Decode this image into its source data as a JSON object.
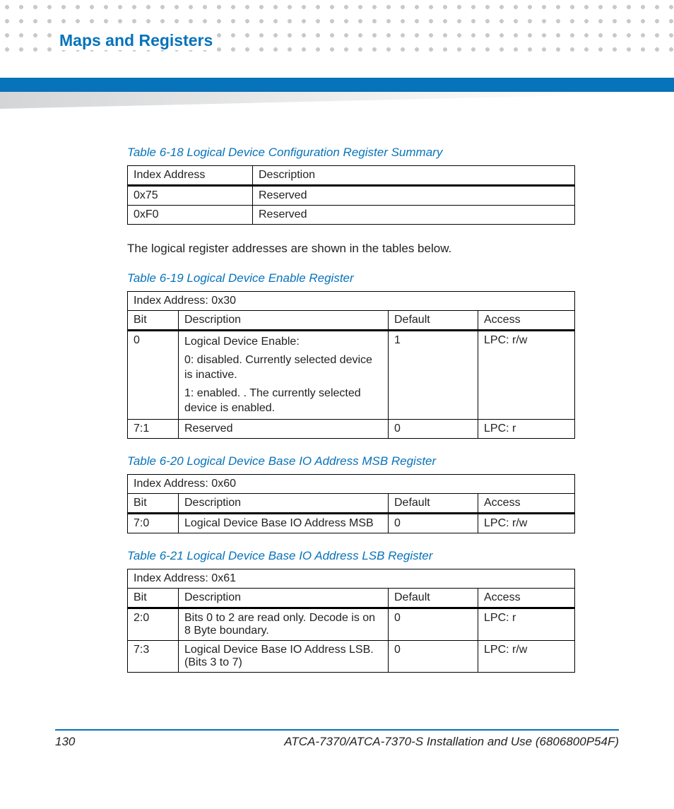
{
  "header": {
    "title": "Maps and Registers"
  },
  "body": {
    "t18": {
      "caption": "Table 6-18 Logical Device Configuration Register Summary",
      "h1": "Index Address",
      "h2": "Description",
      "r1c1": "0x75",
      "r1c2": "Reserved",
      "r2c1": "0xF0",
      "r2c2": "Reserved"
    },
    "para1": "The logical register addresses are shown in the tables below.",
    "t19": {
      "caption": "Table 6-19  Logical Device Enable Register",
      "addr": "Index Address: 0x30",
      "h1": "Bit",
      "h2": "Description",
      "h3": "Default",
      "h4": "Access",
      "r1c1": "0",
      "r1c2_l1": "Logical Device Enable:",
      "r1c2_l2": "0: disabled. Currently selected device is inactive.",
      "r1c2_l3": "1: enabled. . The currently selected device is enabled.",
      "r1c3": "1",
      "r1c4": "LPC: r/w",
      "r2c1": "7:1",
      "r2c2": "Reserved",
      "r2c3": "0",
      "r2c4": "LPC: r"
    },
    "t20": {
      "caption": "Table 6-20 Logical Device Base IO Address MSB Register",
      "addr": "Index Address: 0x60",
      "h1": "Bit",
      "h2": "Description",
      "h3": "Default",
      "h4": "Access",
      "r1c1": "7:0",
      "r1c2": "Logical Device Base IO Address MSB",
      "r1c3": "0",
      "r1c4": "LPC: r/w"
    },
    "t21": {
      "caption": "Table 6-21 Logical Device Base IO Address LSB Register",
      "addr": "Index Address: 0x61",
      "h1": "Bit",
      "h2": "Description",
      "h3": "Default",
      "h4": "Access",
      "r1c1": "2:0",
      "r1c2": "Bits 0 to 2 are read only. Decode is on 8 Byte boundary.",
      "r1c3": "0",
      "r1c4": "LPC: r",
      "r2c1": "7:3",
      "r2c2": "Logical Device Base IO Address LSB. (Bits 3 to 7)",
      "r2c3": "0",
      "r2c4": "LPC: r/w"
    }
  },
  "footer": {
    "page": "130",
    "doc": "ATCA-7370/ATCA-7370-S Installation and Use (6806800P54F)"
  }
}
